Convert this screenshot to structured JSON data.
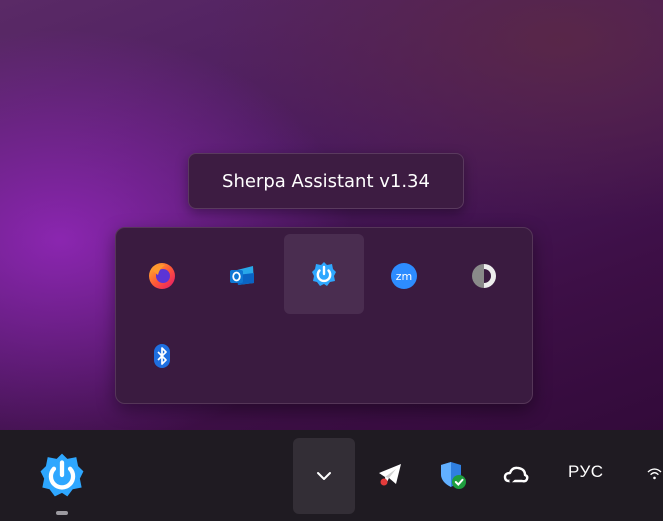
{
  "tooltip": {
    "text": "Sherpa Assistant v1.34"
  },
  "tray_overflow": {
    "items": [
      {
        "name": "firefox-icon"
      },
      {
        "name": "outlook-icon"
      },
      {
        "name": "sherpa-assistant-icon",
        "hovered": true
      },
      {
        "name": "zoom-icon",
        "label": "zm"
      },
      {
        "name": "contrast-icon"
      },
      {
        "name": "bluetooth-icon"
      }
    ]
  },
  "taskbar": {
    "pinned_app": "sherpa-assistant-icon",
    "tray_icons": [
      "chevron-up-icon",
      "telegram-icon",
      "defender-icon",
      "onedrive-icon"
    ],
    "language": "РУС",
    "network_icon": "wifi-icon"
  },
  "colors": {
    "accent": "#1e9bff",
    "panel": "#3a1b40",
    "taskbar": "#1f1b22"
  }
}
